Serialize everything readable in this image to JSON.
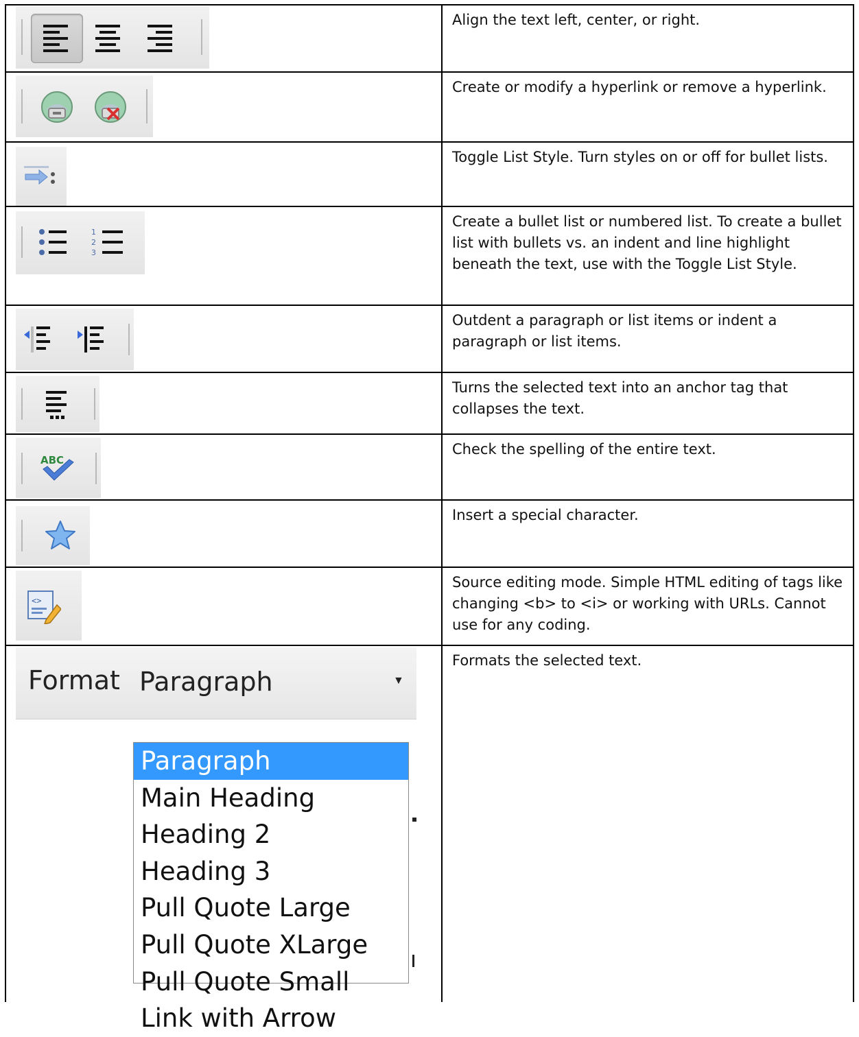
{
  "rows": [
    {
      "icons": [
        "align-left-icon",
        "align-center-icon",
        "align-right-icon"
      ],
      "description": "Align the text left, center, or right."
    },
    {
      "icons": [
        "link-icon",
        "unlink-icon"
      ],
      "description": "Create or modify a hyperlink or remove a hyperlink."
    },
    {
      "icons": [
        "toggle-list-style-icon"
      ],
      "description": "Toggle List Style. Turn styles on or off for bullet lists."
    },
    {
      "icons": [
        "bulleted-list-icon",
        "numbered-list-icon"
      ],
      "description": "Create a bullet list or numbered list. To create a bullet list with bullets vs. an indent and line highlight beneath the text, use with the Toggle List Style."
    },
    {
      "icons": [
        "outdent-icon",
        "indent-icon"
      ],
      "description": "Outdent a paragraph or list items or indent a paragraph or list items."
    },
    {
      "icons": [
        "collapse-text-icon"
      ],
      "description": "Turns the selected text into an anchor tag that collapses the text."
    },
    {
      "icons": [
        "spellcheck-icon"
      ],
      "description": "Check the spelling of the entire text."
    },
    {
      "icons": [
        "special-character-icon"
      ],
      "description": "Insert a special character."
    },
    {
      "icons": [
        "source-editing-icon"
      ],
      "description": "Source editing mode. Simple HTML editing of tags like changing <b> to <i> or working with URLs. Cannot use for any coding."
    },
    {
      "icons": [
        "format-dropdown"
      ],
      "description": "Formats the selected text."
    }
  ],
  "format": {
    "label": "Format",
    "value": "Paragraph",
    "options": [
      "Paragraph",
      "Main Heading",
      "Heading 2",
      "Heading 3",
      "Pull Quote Large",
      "Pull Quote XLarge",
      "Pull Quote Small",
      "Link with Arrow"
    ],
    "selected_index": 0
  },
  "colors": {
    "selection": "#3399ff",
    "border": "#000000",
    "toolbar": "#e8e8e8"
  }
}
